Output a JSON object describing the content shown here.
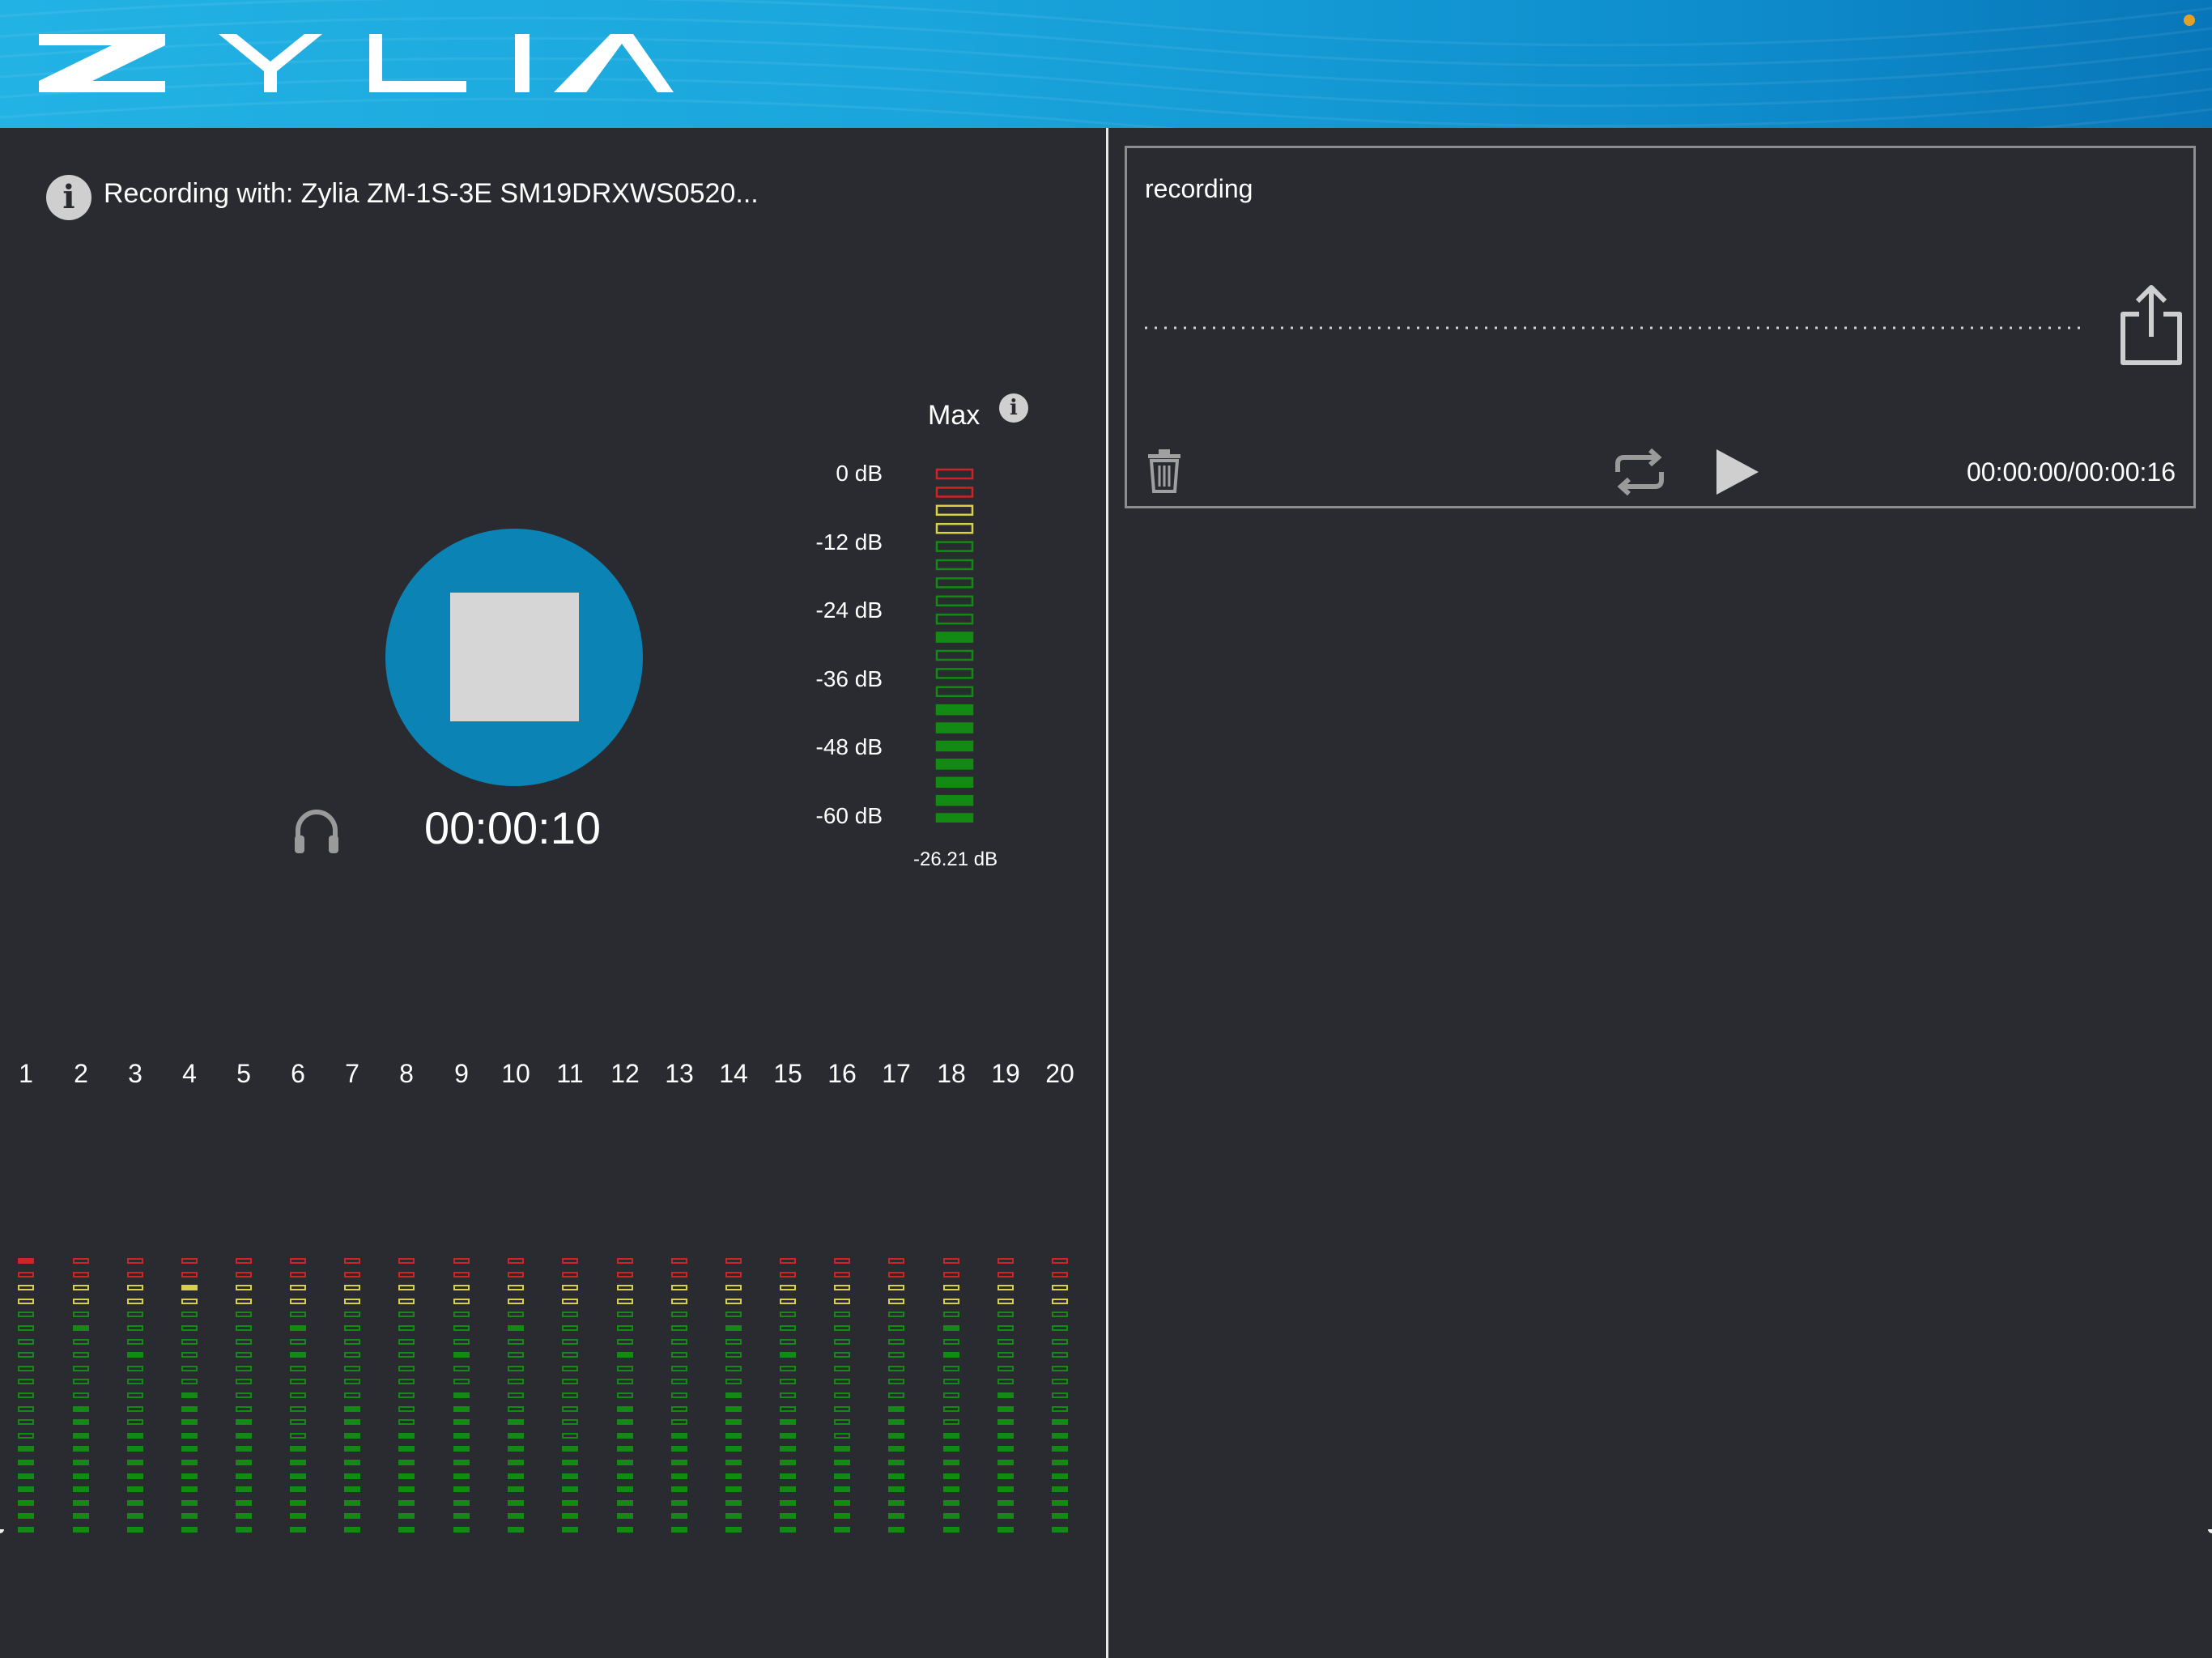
{
  "app": {
    "logo_text": "ZYLIA",
    "colors": {
      "accent": "#0b84b5",
      "header": "#1aa6dc",
      "background": "#2a2b30",
      "status_dot": "#e5a02a"
    }
  },
  "recorder": {
    "device_label": "Recording with: Zylia ZM-1S-3E SM19DRXWS0520...",
    "timer": "00:00:10",
    "max_meter": {
      "title": "Max",
      "scale_labels": [
        "0 dB",
        "-12 dB",
        "-24 dB",
        "-36 dB",
        "-48 dB",
        "-60 dB"
      ],
      "value_label": "-26.21 dB"
    }
  },
  "channels": {
    "labels": [
      "1",
      "2",
      "3",
      "4",
      "5",
      "6",
      "7",
      "8",
      "9",
      "10",
      "11",
      "12",
      "13",
      "14",
      "15",
      "16",
      "17",
      "18",
      "19",
      "20"
    ]
  },
  "recordings": [
    {
      "name": "recording",
      "time_display": "00:00:00/00:00:16"
    }
  ]
}
